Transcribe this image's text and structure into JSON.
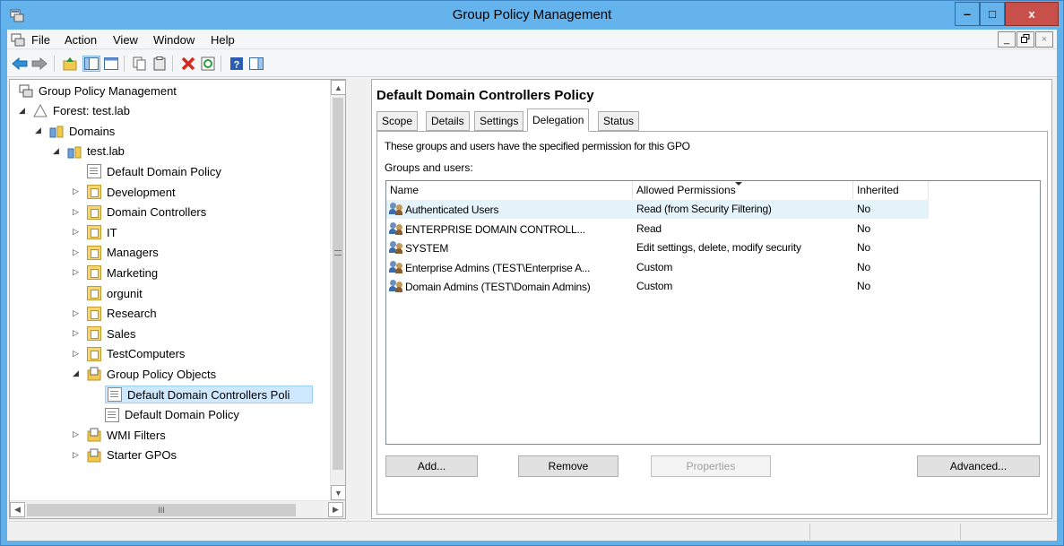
{
  "window": {
    "title": "Group Policy Management",
    "title_bar_color": "#65b3ec",
    "close_color": "#c7504a",
    "minimize_glyph": "‒",
    "maximize_glyph": "□",
    "close_glyph": "x"
  },
  "menubar": {
    "items": [
      "File",
      "Action",
      "View",
      "Window",
      "Help"
    ],
    "mdi_min": "_",
    "mdi_restore": "🗗",
    "mdi_close": "×"
  },
  "toolbar": {
    "icons": [
      "back-arrow-icon",
      "forward-arrow-icon",
      "up-folder-icon",
      "show-hide-tree-icon",
      "copy-icon",
      "paste-icon",
      "delete-icon",
      "refresh-icon",
      "help-icon",
      "properties-pane-icon"
    ]
  },
  "tree": {
    "items": [
      {
        "label": "Group Policy Management",
        "icon": "gpm-console-icon"
      },
      {
        "label": "Forest: test.lab",
        "icon": "forest-icon"
      },
      {
        "label": "Domains",
        "icon": "domains-icon"
      },
      {
        "label": "test.lab",
        "icon": "domain-icon"
      },
      {
        "label": "Default Domain Policy",
        "icon": "gpo-link-icon"
      },
      {
        "label": "Development",
        "icon": "ou-icon"
      },
      {
        "label": "Domain Controllers",
        "icon": "ou-icon"
      },
      {
        "label": "IT",
        "icon": "ou-icon"
      },
      {
        "label": "Managers",
        "icon": "ou-icon"
      },
      {
        "label": "Marketing",
        "icon": "ou-icon"
      },
      {
        "label": "orgunit",
        "icon": "ou-icon"
      },
      {
        "label": "Research",
        "icon": "ou-icon"
      },
      {
        "label": "Sales",
        "icon": "ou-icon"
      },
      {
        "label": "TestComputers",
        "icon": "ou-icon"
      },
      {
        "label": "Group Policy Objects",
        "icon": "gpo-container-icon"
      },
      {
        "label": "Default Domain Controllers Poli",
        "icon": "gpo-icon",
        "selected": true
      },
      {
        "label": "Default Domain Policy",
        "icon": "gpo-icon"
      },
      {
        "label": "WMI Filters",
        "icon": "wmi-filter-icon"
      },
      {
        "label": "Starter GPOs",
        "icon": "starter-gpo-icon"
      }
    ],
    "hscroll_thumb": "III"
  },
  "details": {
    "policy_title": "Default Domain Controllers Policy",
    "tabs": [
      {
        "label": "Scope"
      },
      {
        "label": "Details"
      },
      {
        "label": "Settings"
      },
      {
        "label": "Delegation",
        "selected": true
      },
      {
        "label": "Status"
      }
    ],
    "description": "These groups and users have the specified permission for this GPO",
    "groups_label": "Groups and users:",
    "columns": [
      "Name",
      "Allowed Permissions",
      "Inherited"
    ],
    "rows": [
      {
        "name": "Authenticated Users",
        "permissions": "Read (from Security Filtering)",
        "inherited": "No"
      },
      {
        "name": "ENTERPRISE DOMAIN CONTROLL...",
        "permissions": "Read",
        "inherited": "No"
      },
      {
        "name": "SYSTEM",
        "permissions": "Edit settings, delete, modify security",
        "inherited": "No"
      },
      {
        "name": "Enterprise Admins (TEST\\Enterprise A...",
        "permissions": "Custom",
        "inherited": "No"
      },
      {
        "name": "Domain Admins (TEST\\Domain Admins)",
        "permissions": "Custom",
        "inherited": "No"
      }
    ],
    "buttons": {
      "add": "Add...",
      "remove": "Remove",
      "properties": "Properties",
      "advanced": "Advanced..."
    }
  }
}
